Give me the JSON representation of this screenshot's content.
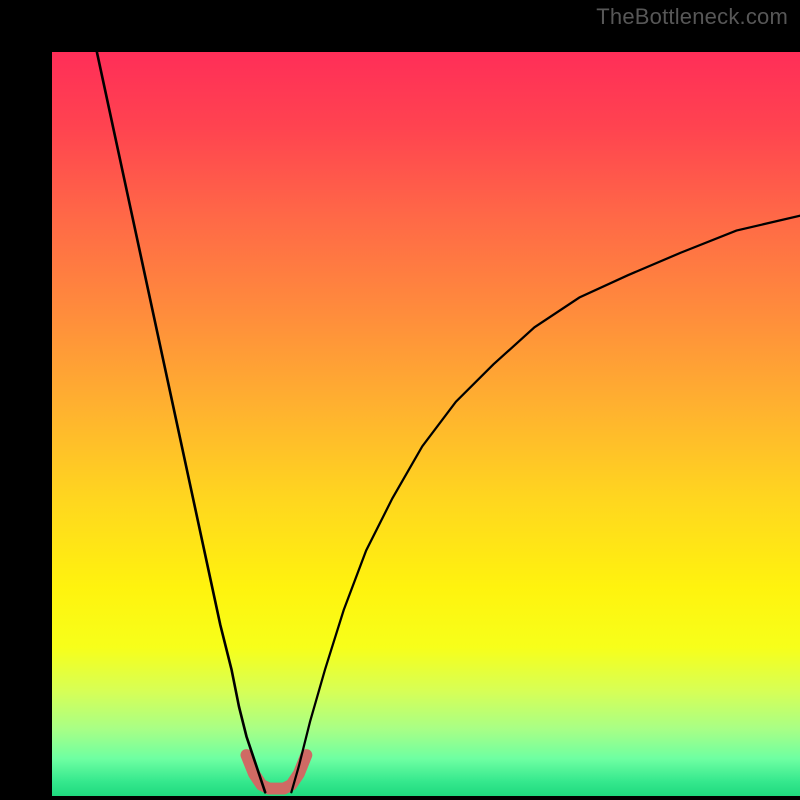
{
  "watermark": {
    "text": "TheBottleneck.com"
  },
  "chart_data": {
    "type": "line",
    "title": "",
    "xlabel": "",
    "ylabel": "",
    "xlim": [
      0,
      100
    ],
    "ylim": [
      0,
      100
    ],
    "grid": false,
    "legend": null,
    "series": [
      {
        "name": "curve-left",
        "x": [
          6.0,
          7.5,
          9.0,
          10.5,
          12.0,
          13.5,
          15.0,
          16.5,
          18.0,
          19.5,
          21.0,
          22.5,
          24.0,
          25.0,
          26.0,
          27.0,
          28.0,
          28.5
        ],
        "y": [
          100,
          93,
          86,
          79,
          72,
          65,
          58,
          51,
          44,
          37,
          30,
          23,
          17,
          12,
          8,
          5,
          2,
          0.5
        ]
      },
      {
        "name": "curve-right",
        "x": [
          32.0,
          33.0,
          34.5,
          36.5,
          39.0,
          42.0,
          45.5,
          49.5,
          54.0,
          59.0,
          64.5,
          70.5,
          77.0,
          84.0,
          91.5,
          100.0
        ],
        "y": [
          0.5,
          4,
          10,
          17,
          25,
          33,
          40,
          47,
          53,
          58,
          63,
          67,
          70,
          73,
          76,
          78
        ]
      },
      {
        "name": "valley-floor",
        "x": [
          26.0,
          27.0,
          28.0,
          29.0,
          30.0,
          31.0,
          32.0,
          33.0,
          34.0
        ],
        "y": [
          5.5,
          3.0,
          1.5,
          1.0,
          1.0,
          1.0,
          1.5,
          3.0,
          5.5
        ]
      }
    ],
    "gradient_stops": [
      {
        "offset": 0.0,
        "color": "#ff2e58"
      },
      {
        "offset": 0.1,
        "color": "#ff4350"
      },
      {
        "offset": 0.22,
        "color": "#ff6847"
      },
      {
        "offset": 0.35,
        "color": "#ff8c3c"
      },
      {
        "offset": 0.48,
        "color": "#ffb22f"
      },
      {
        "offset": 0.6,
        "color": "#ffd61f"
      },
      {
        "offset": 0.72,
        "color": "#fff30e"
      },
      {
        "offset": 0.8,
        "color": "#f7ff1a"
      },
      {
        "offset": 0.86,
        "color": "#d6ff57"
      },
      {
        "offset": 0.91,
        "color": "#a8ff86"
      },
      {
        "offset": 0.95,
        "color": "#6effa2"
      },
      {
        "offset": 0.98,
        "color": "#36e98e"
      },
      {
        "offset": 1.0,
        "color": "#1fd97e"
      }
    ],
    "valley_color": "#cf6a64",
    "curve_color": "#000000"
  }
}
